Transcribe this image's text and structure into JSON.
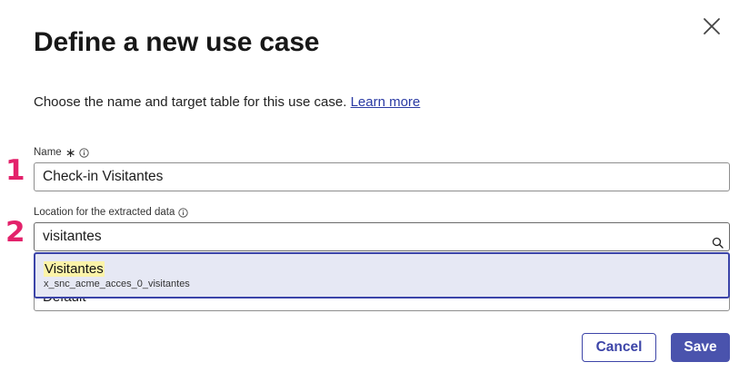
{
  "dialog": {
    "title": "Define a new use case",
    "description": "Choose the name and target table for this use case.",
    "learn_more": "Learn more"
  },
  "steps": [
    "1",
    "2"
  ],
  "name_field": {
    "label": "Name",
    "required_marker": "∗",
    "value": "Check-in Visitantes"
  },
  "location_field": {
    "label": "Location for the extracted data",
    "value": "visitantes"
  },
  "dropdown": {
    "option_title": "Visitantes",
    "option_subtitle": "x_snc_acme_acces_0_visitantes"
  },
  "hidden_field": {
    "value": "Default"
  },
  "buttons": {
    "cancel": "Cancel",
    "save": "Save"
  },
  "colors": {
    "accent": "#4a53ad",
    "step_marker": "#e3226b",
    "highlight": "#fbf3a9",
    "dropdown_bg": "#e6e8f4"
  }
}
